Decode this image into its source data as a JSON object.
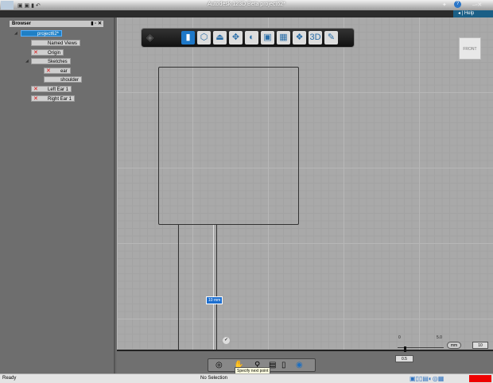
{
  "window": {
    "title": "Autodesk 123D Beta  project62*",
    "help": "Help"
  },
  "browser": {
    "title": "Browser",
    "items": [
      {
        "label": "project62*",
        "selected": true
      },
      {
        "label": "Named Views"
      },
      {
        "label": "Origin"
      },
      {
        "label": "Sketches"
      },
      {
        "label": "ear"
      },
      {
        "label": "shoulder"
      },
      {
        "label": "Left Ear 1"
      },
      {
        "label": "Right Ear 1"
      }
    ]
  },
  "viewcube": {
    "label": "FRONT"
  },
  "canvas": {
    "dimension": "10 mm",
    "tooltip": "Specify next point"
  },
  "ruler": {
    "tick0": "0",
    "tick1": "5.0",
    "unit": "mm",
    "value": "10",
    "scale": "0.5"
  },
  "status": {
    "left": "Ready",
    "center": "No Selection"
  }
}
